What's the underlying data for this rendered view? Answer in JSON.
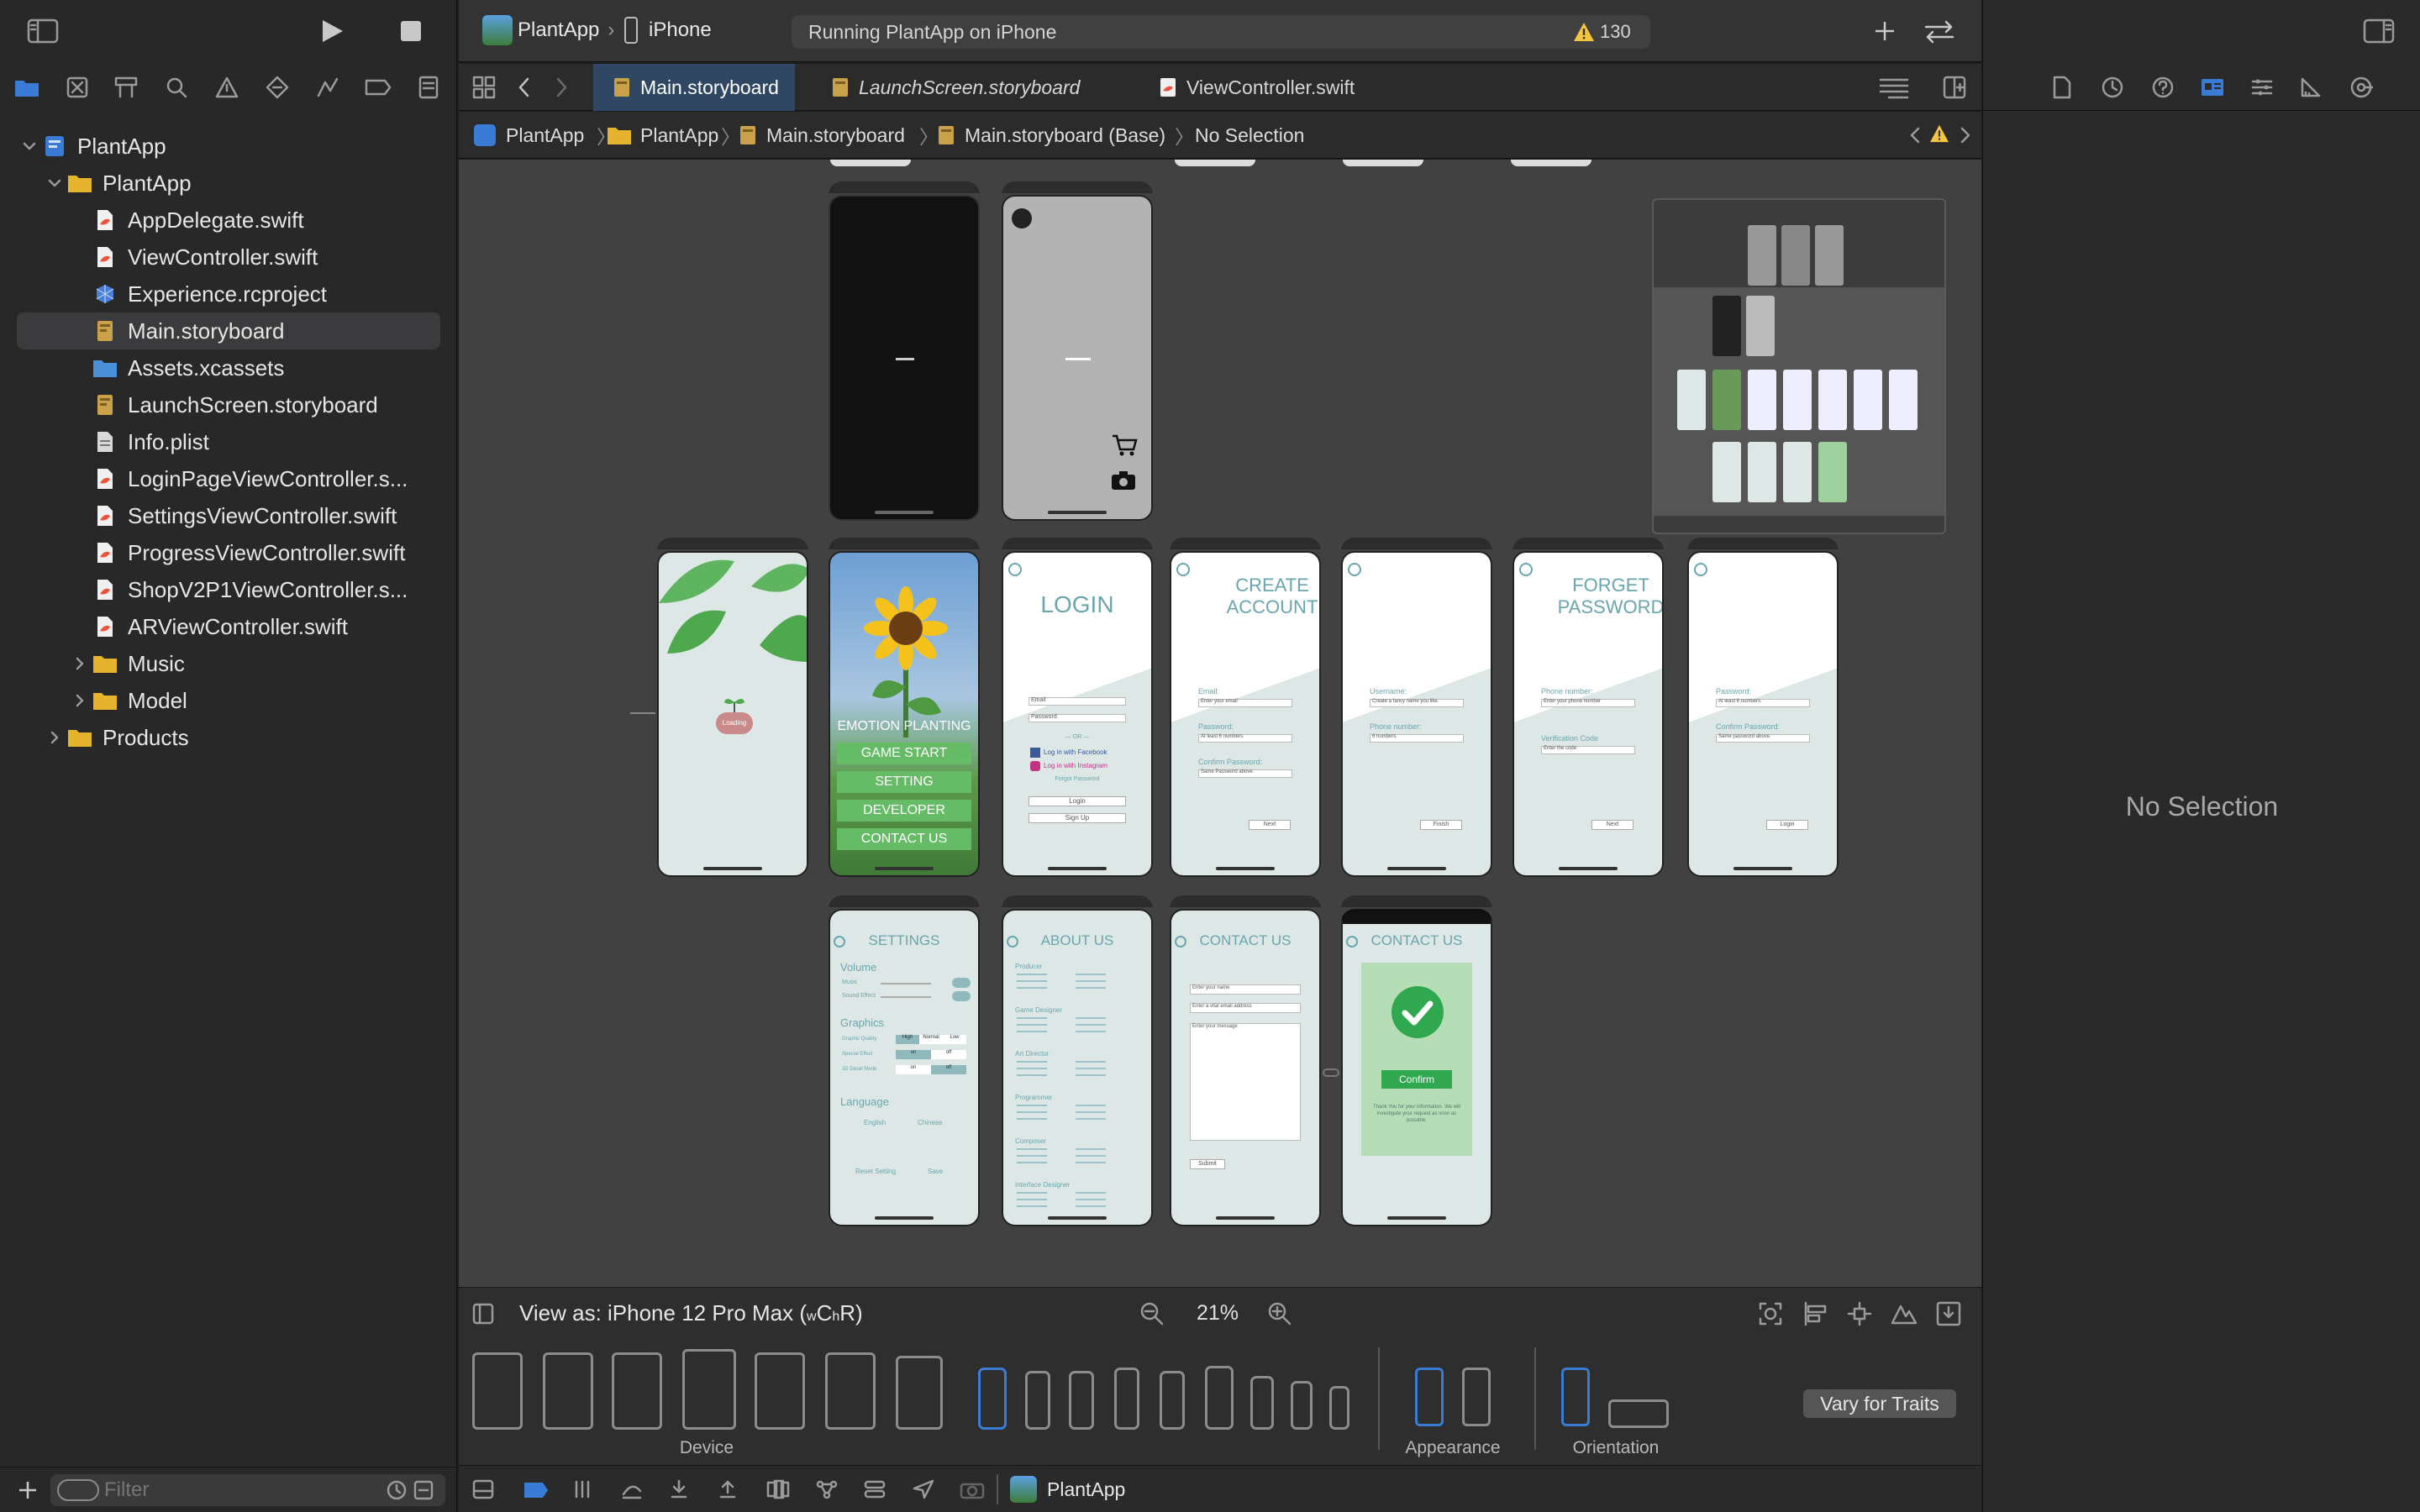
{
  "project": {
    "scheme": "PlantApp",
    "destination": "iPhone",
    "status": "Running PlantApp on iPhone",
    "warnings": "130"
  },
  "tabs": [
    {
      "label": "Main.storyboard",
      "active": true
    },
    {
      "label": "LaunchScreen.storyboard",
      "active": false
    },
    {
      "label": "ViewController.swift",
      "active": false
    }
  ],
  "breadcrumb": [
    "PlantApp",
    "PlantApp",
    "Main.storyboard",
    "Main.storyboard (Base)",
    "No Selection"
  ],
  "navigator": {
    "items": [
      {
        "label": "PlantApp",
        "level": 0,
        "icon": "project-icon",
        "expanded": true
      },
      {
        "label": "PlantApp",
        "level": 1,
        "icon": "folder-icon",
        "expanded": true
      },
      {
        "label": "AppDelegate.swift",
        "level": 2,
        "icon": "swift-file-icon"
      },
      {
        "label": "ViewController.swift",
        "level": 2,
        "icon": "swift-file-icon"
      },
      {
        "label": "Experience.rcproject",
        "level": 2,
        "icon": "rcproject-icon"
      },
      {
        "label": "Main.storyboard",
        "level": 2,
        "icon": "storyboard-icon",
        "selected": true
      },
      {
        "label": "Assets.xcassets",
        "level": 2,
        "icon": "assets-folder-icon"
      },
      {
        "label": "LaunchScreen.storyboard",
        "level": 2,
        "icon": "storyboard-icon"
      },
      {
        "label": "Info.plist",
        "level": 2,
        "icon": "plist-icon"
      },
      {
        "label": "LoginPageViewController.s...",
        "level": 2,
        "icon": "swift-file-icon"
      },
      {
        "label": "SettingsViewController.swift",
        "level": 2,
        "icon": "swift-file-icon"
      },
      {
        "label": "ProgressViewController.swift",
        "level": 2,
        "icon": "swift-file-icon"
      },
      {
        "label": "ShopV2P1ViewController.s...",
        "level": 2,
        "icon": "swift-file-icon"
      },
      {
        "label": "ARViewController.swift",
        "level": 2,
        "icon": "swift-file-icon"
      },
      {
        "label": "Music",
        "level": 2,
        "icon": "folder-icon",
        "expanded": false
      },
      {
        "label": "Model",
        "level": 2,
        "icon": "folder-icon",
        "expanded": false
      },
      {
        "label": "Products",
        "level": 1,
        "icon": "folder-icon",
        "expanded": false
      }
    ],
    "filter_placeholder": "Filter"
  },
  "storyboard": {
    "menu": {
      "title": "EMOTION PLANTING",
      "buttons": [
        "GAME START",
        "SETTING",
        "DEVELOPER",
        "CONTACT US"
      ]
    },
    "login": {
      "title": "LOGIN",
      "email": "Email",
      "password": "Password",
      "or": "— OR —",
      "facebook": "Log in with Facebook",
      "instagram": "Log in with Instagram",
      "forgot": "Forgot Password",
      "login_btn": "Login",
      "signup_btn": "Sign Up"
    },
    "create": {
      "title1": "CREATE",
      "title2": "ACCOUNT",
      "email_lbl": "Email:",
      "email_ph": "Enter your email",
      "pw_lbl": "Password:",
      "pw_ph": "At least 6 numbers.",
      "confirm_lbl": "Confirm Password:",
      "confirm_ph": "Same Password above.",
      "next": "Next"
    },
    "username": {
      "user_lbl": "Username:",
      "user_ph": "Create a fancy name you like.",
      "phone_lbl": "Phone number:",
      "phone_ph": "6 numbers.",
      "finish": "Finish"
    },
    "forget": {
      "title1": "FORGET",
      "title2": "PASSWORD",
      "phone_lbl": "Phone number:",
      "phone_ph": "Enter your phone number",
      "code_lbl": "Verification Code",
      "code_ph": "Enter the code",
      "next": "Next"
    },
    "reset": {
      "pw_lbl": "Password:",
      "pw_ph": "At least 6 numbers.",
      "confirm_lbl": "Confirm Password:",
      "confirm_ph": "Same password above.",
      "login": "Login"
    },
    "loading": "Loading",
    "settings": {
      "title": "SETTINGS",
      "volume": "Volume",
      "music": "Music",
      "sound": "Sound Effect",
      "graphics": "Graphics",
      "quality": "Graphic Quality",
      "effect": "Special Effect",
      "detail": "3D Detail Mode",
      "high": "High",
      "normal": "Normal",
      "low": "Low",
      "on": "on",
      "off": "off",
      "language": "Language",
      "english": "English",
      "chinese": "Chinese",
      "reset": "Reset Setting",
      "save": "Save"
    },
    "about": {
      "title": "ABOUT US",
      "sections": [
        "Producer",
        "Game Designer",
        "Art Director",
        "Programmer",
        "Composer",
        "Interface Designer"
      ]
    },
    "contact": {
      "title": "CONTACT US",
      "name_ph": "Enter your name",
      "email_ph": "Enter a vital email address",
      "msg_ph": "Enter your message",
      "submit": "Submit"
    },
    "contact_done": {
      "title": "CONTACT US",
      "confirm": "Confirm",
      "thanks": "Thank You for your information. We will investigate your request as soon as possible."
    }
  },
  "viewas": {
    "label": "View as: iPhone 12 Pro Max (",
    "w": "w",
    "c": "C ",
    "h": "h",
    "r": "R)",
    "zoom": "21%"
  },
  "device_bar": {
    "device_label": "Device",
    "appearance_label": "Appearance",
    "orientation_label": "Orientation",
    "vary_button": "Vary for Traits"
  },
  "debug": {
    "target": "PlantApp"
  },
  "inspector": {
    "empty": "No Selection"
  },
  "colors": {
    "accent": "#3a7bd5",
    "screen_bg": "#dde8e6",
    "teal_text": "#6aa6ad",
    "menu_button": "#66bb66",
    "warning": "#f5c542",
    "swift": "#f05138"
  }
}
